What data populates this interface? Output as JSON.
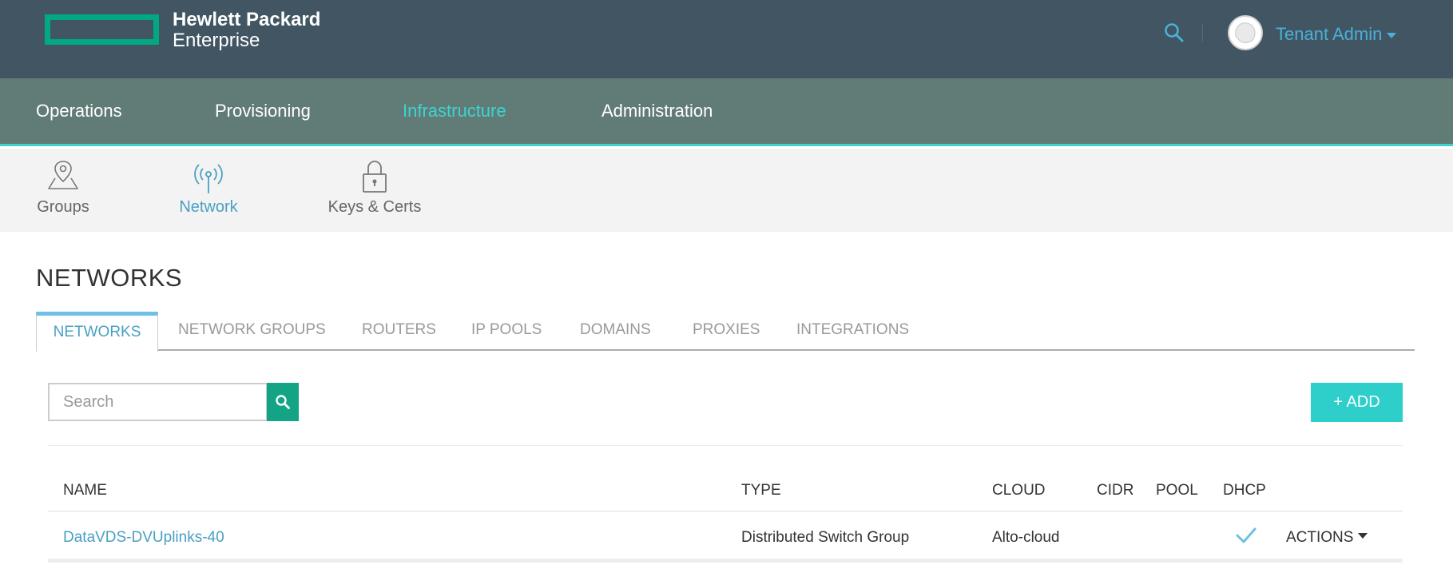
{
  "header": {
    "brand_line1": "Hewlett Packard",
    "brand_line2": "Enterprise",
    "user_name": "Tenant Admin",
    "brand_color": "#01a982",
    "bar_color": "#415563"
  },
  "main_nav": {
    "items": [
      "Operations",
      "Provisioning",
      "Infrastructure",
      "Administration"
    ],
    "active": "Infrastructure",
    "accent_color": "#3ed3d0"
  },
  "sub_nav": {
    "items": [
      {
        "label": "Groups",
        "icon": "map-pin-icon"
      },
      {
        "label": "Network",
        "icon": "antenna-icon"
      },
      {
        "label": "Keys & Certs",
        "icon": "lock-icon"
      }
    ],
    "active": "Network"
  },
  "page": {
    "title": "NETWORKS"
  },
  "tabs": {
    "items": [
      "NETWORKS",
      "NETWORK GROUPS",
      "ROUTERS",
      "IP POOLS",
      "DOMAINS",
      "PROXIES",
      "INTEGRATIONS"
    ],
    "active": "NETWORKS"
  },
  "toolbar": {
    "search_placeholder": "Search",
    "add_label": "+ ADD"
  },
  "table": {
    "columns": [
      "NAME",
      "TYPE",
      "CLOUD",
      "CIDR",
      "POOL",
      "DHCP"
    ],
    "rows": [
      {
        "name": "DataVDS-DVUplinks-40",
        "type": "Distributed Switch Group",
        "cloud": "Alto-cloud",
        "cidr": "",
        "pool": "",
        "dhcp": true,
        "actions_label": "ACTIONS"
      }
    ]
  }
}
